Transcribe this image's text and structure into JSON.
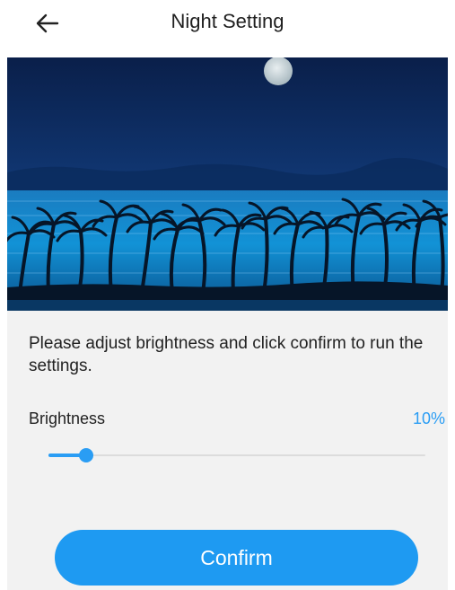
{
  "header": {
    "title": "Night Setting",
    "back_icon": "arrow-left-icon"
  },
  "hero": {
    "description": "Night scene photo: full moon over the sea with a row of palm trees",
    "colors": {
      "sky": "#0c2a5c",
      "water": "#0d6fb0",
      "moon": "#cfd8dc"
    }
  },
  "settings": {
    "description": "Please adjust brightness and click confirm to run the settings.",
    "brightness_label": "Brightness",
    "brightness_value": "10%",
    "brightness_level": 0.1
  },
  "confirm_label": "Confirm",
  "colors": {
    "accent": "#2a9df4",
    "button": "#1e9af2",
    "panel": "#f2f2f2"
  }
}
